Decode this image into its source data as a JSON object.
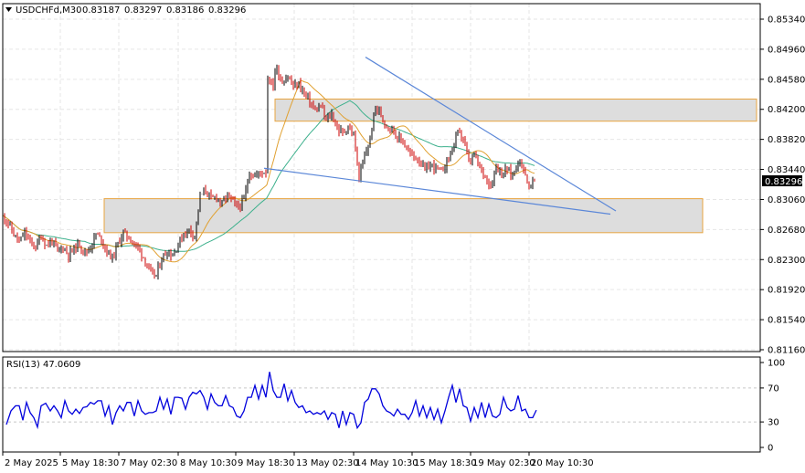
{
  "chart_data": [
    {
      "type": "candlestick",
      "symbol": "USDCHFd",
      "timeframe": "M30",
      "ohlc": {
        "open": "0.83187",
        "high": "0.83297",
        "low": "0.83186",
        "close": "0.83296"
      },
      "price_ticks": [
        "0.85340",
        "0.84960",
        "0.84580",
        "0.84200",
        "0.83820",
        "0.83440",
        "0.83060",
        "0.82680",
        "0.82300",
        "0.81920",
        "0.81540",
        "0.81160"
      ],
      "ylim": [
        0.8116,
        0.8534
      ],
      "time_ticks": [
        "2 May 2025",
        "5 May 18:30",
        "7 May 02:30",
        "8 May 10:30",
        "9 May 18:30",
        "13 May 02:30",
        "14 May 10:30",
        "15 May 18:30",
        "19 May 02:30",
        "20 May 10:30"
      ],
      "current_price": "0.83296",
      "close_series": [
        [
          0,
          0.8286
        ],
        [
          6,
          0.8276
        ],
        [
          12,
          0.8262
        ],
        [
          18,
          0.8252
        ],
        [
          24,
          0.8264
        ],
        [
          30,
          0.8252
        ],
        [
          36,
          0.8246
        ],
        [
          42,
          0.826
        ],
        [
          48,
          0.8248
        ],
        [
          54,
          0.8254
        ],
        [
          60,
          0.824
        ],
        [
          66,
          0.8246
        ],
        [
          72,
          0.8236
        ],
        [
          78,
          0.8244
        ],
        [
          84,
          0.825
        ],
        [
          90,
          0.8238
        ],
        [
          96,
          0.8246
        ],
        [
          102,
          0.8262
        ],
        [
          108,
          0.8256
        ],
        [
          114,
          0.824
        ],
        [
          120,
          0.8232
        ],
        [
          126,
          0.825
        ],
        [
          132,
          0.8264
        ],
        [
          138,
          0.8258
        ],
        [
          144,
          0.825
        ],
        [
          150,
          0.8242
        ],
        [
          156,
          0.8228
        ],
        [
          162,
          0.8212
        ],
        [
          168,
          0.821
        ],
        [
          174,
          0.8232
        ],
        [
          180,
          0.824
        ],
        [
          186,
          0.8236
        ],
        [
          192,
          0.825
        ],
        [
          198,
          0.8262
        ],
        [
          204,
          0.8268
        ],
        [
          210,
          0.826
        ],
        [
          216,
          0.831
        ],
        [
          222,
          0.8318
        ],
        [
          228,
          0.8306
        ],
        [
          234,
          0.831
        ],
        [
          240,
          0.83
        ],
        [
          246,
          0.8312
        ],
        [
          252,
          0.8302
        ],
        [
          258,
          0.8296
        ],
        [
          264,
          0.8306
        ],
        [
          270,
          0.834
        ],
        [
          276,
          0.8336
        ],
        [
          282,
          0.834
        ],
        [
          288,
          0.8342
        ],
        [
          292,
          0.846
        ],
        [
          296,
          0.845
        ],
        [
          300,
          0.847
        ],
        [
          306,
          0.8455
        ],
        [
          312,
          0.8462
        ],
        [
          318,
          0.8448
        ],
        [
          324,
          0.8452
        ],
        [
          330,
          0.844
        ],
        [
          336,
          0.843
        ],
        [
          342,
          0.8418
        ],
        [
          348,
          0.8424
        ],
        [
          354,
          0.8406
        ],
        [
          360,
          0.8414
        ],
        [
          366,
          0.8396
        ],
        [
          372,
          0.839
        ],
        [
          378,
          0.8398
        ],
        [
          384,
          0.8386
        ],
        [
          390,
          0.8334
        ],
        [
          396,
          0.836
        ],
        [
          402,
          0.8382
        ],
        [
          408,
          0.8424
        ],
        [
          414,
          0.8412
        ],
        [
          420,
          0.84
        ],
        [
          426,
          0.8396
        ],
        [
          432,
          0.8384
        ],
        [
          438,
          0.838
        ],
        [
          444,
          0.8366
        ],
        [
          450,
          0.836
        ],
        [
          456,
          0.8356
        ],
        [
          462,
          0.8342
        ],
        [
          468,
          0.835
        ],
        [
          474,
          0.8346
        ],
        [
          480,
          0.834
        ],
        [
          486,
          0.8354
        ],
        [
          492,
          0.837
        ],
        [
          498,
          0.839
        ],
        [
          504,
          0.8384
        ],
        [
          510,
          0.8352
        ],
        [
          516,
          0.8362
        ],
        [
          522,
          0.8346
        ],
        [
          528,
          0.8336
        ],
        [
          534,
          0.8322
        ],
        [
          540,
          0.835
        ],
        [
          546,
          0.8338
        ],
        [
          552,
          0.8344
        ],
        [
          558,
          0.8336
        ],
        [
          564,
          0.8356
        ],
        [
          570,
          0.8346
        ],
        [
          576,
          0.832
        ],
        [
          582,
          0.833
        ]
      ],
      "overlays": {
        "zones": [
          {
            "x0": 301,
            "x1": 828,
            "y0": 0.8405,
            "y1": 0.8433,
            "fill": "#dddddd",
            "stroke": "#e8a540"
          },
          {
            "x0": 114,
            "x1": 769,
            "y0": 0.8264,
            "y1": 0.8307,
            "fill": "#dddddd",
            "stroke": "#e8a540"
          }
        ],
        "trendlines": [
          {
            "x0": 400,
            "y0": 0.8486,
            "x1": 674,
            "y1": 0.82915,
            "color": "#5b87d8"
          },
          {
            "x0": 289,
            "y0": 0.83455,
            "x1": 668,
            "y1": 0.82875,
            "color": "#5b87d8"
          }
        ]
      }
    },
    {
      "type": "line",
      "name": "RSI(13) 47.0609",
      "ylim": [
        0,
        100
      ],
      "levels": [
        "100",
        "70",
        "30",
        "0"
      ],
      "series": [
        [
          4,
          30
        ],
        [
          9,
          40
        ],
        [
          14,
          52
        ],
        [
          18,
          46
        ],
        [
          22,
          35
        ],
        [
          26,
          50
        ],
        [
          30,
          44
        ],
        [
          34,
          32
        ],
        [
          38,
          27
        ],
        [
          42,
          46
        ],
        [
          47,
          55
        ],
        [
          52,
          40
        ],
        [
          56,
          52
        ],
        [
          60,
          40
        ],
        [
          64,
          38
        ],
        [
          68,
          52
        ],
        [
          72,
          46
        ],
        [
          76,
          36
        ],
        [
          80,
          48
        ],
        [
          84,
          37
        ],
        [
          88,
          50
        ],
        [
          92,
          45
        ],
        [
          96,
          56
        ],
        [
          100,
          48
        ],
        [
          104,
          58
        ],
        [
          108,
          52
        ],
        [
          112,
          40
        ],
        [
          116,
          46
        ],
        [
          120,
          30
        ],
        [
          124,
          38
        ],
        [
          128,
          52
        ],
        [
          132,
          40
        ],
        [
          136,
          56
        ],
        [
          140,
          50
        ],
        [
          144,
          40
        ],
        [
          148,
          52
        ],
        [
          152,
          46
        ],
        [
          156,
          36
        ],
        [
          160,
          44
        ],
        [
          164,
          38
        ],
        [
          168,
          46
        ],
        [
          172,
          56
        ],
        [
          176,
          48
        ],
        [
          180,
          54
        ],
        [
          184,
          42
        ],
        [
          188,
          56
        ],
        [
          192,
          62
        ],
        [
          196,
          55
        ],
        [
          200,
          48
        ],
        [
          204,
          56
        ],
        [
          208,
          68
        ],
        [
          212,
          60
        ],
        [
          216,
          70
        ],
        [
          220,
          56
        ],
        [
          224,
          48
        ],
        [
          228,
          60
        ],
        [
          232,
          56
        ],
        [
          236,
          46
        ],
        [
          240,
          52
        ],
        [
          244,
          58
        ],
        [
          248,
          52
        ],
        [
          252,
          44
        ],
        [
          256,
          40
        ],
        [
          260,
          32
        ],
        [
          264,
          46
        ],
        [
          268,
          56
        ],
        [
          272,
          62
        ],
        [
          276,
          70
        ],
        [
          280,
          60
        ],
        [
          284,
          70
        ],
        [
          288,
          62
        ],
        [
          292,
          86
        ],
        [
          296,
          70
        ],
        [
          300,
          56
        ],
        [
          304,
          62
        ],
        [
          308,
          72
        ],
        [
          312,
          58
        ],
        [
          316,
          64
        ],
        [
          320,
          56
        ],
        [
          324,
          44
        ],
        [
          328,
          52
        ],
        [
          332,
          38
        ],
        [
          336,
          46
        ],
        [
          340,
          36
        ],
        [
          344,
          44
        ],
        [
          348,
          36
        ],
        [
          352,
          46
        ],
        [
          356,
          30
        ],
        [
          360,
          44
        ],
        [
          364,
          36
        ],
        [
          368,
          26
        ],
        [
          372,
          40
        ],
        [
          376,
          30
        ],
        [
          380,
          38
        ],
        [
          384,
          42
        ],
        [
          388,
          20
        ],
        [
          392,
          32
        ],
        [
          396,
          50
        ],
        [
          400,
          60
        ],
        [
          404,
          66
        ],
        [
          408,
          72
        ],
        [
          412,
          60
        ],
        [
          416,
          52
        ],
        [
          420,
          40
        ],
        [
          424,
          44
        ],
        [
          428,
          34
        ],
        [
          432,
          48
        ],
        [
          436,
          36
        ],
        [
          440,
          42
        ],
        [
          444,
          30
        ],
        [
          448,
          44
        ],
        [
          452,
          52
        ],
        [
          456,
          40
        ],
        [
          460,
          46
        ],
        [
          464,
          38
        ],
        [
          468,
          44
        ],
        [
          472,
          36
        ],
        [
          476,
          42
        ],
        [
          480,
          32
        ],
        [
          484,
          40
        ],
        [
          488,
          62
        ],
        [
          492,
          70
        ],
        [
          496,
          56
        ],
        [
          500,
          66
        ],
        [
          504,
          52
        ],
        [
          508,
          44
        ],
        [
          512,
          34
        ],
        [
          516,
          44
        ],
        [
          520,
          38
        ],
        [
          524,
          50
        ],
        [
          528,
          38
        ],
        [
          532,
          48
        ],
        [
          536,
          40
        ],
        [
          540,
          32
        ],
        [
          544,
          42
        ],
        [
          548,
          56
        ],
        [
          552,
          50
        ],
        [
          556,
          40
        ],
        [
          560,
          48
        ],
        [
          564,
          58
        ],
        [
          568,
          46
        ],
        [
          572,
          42
        ],
        [
          576,
          38
        ],
        [
          580,
          32
        ],
        [
          584,
          47
        ]
      ]
    }
  ]
}
